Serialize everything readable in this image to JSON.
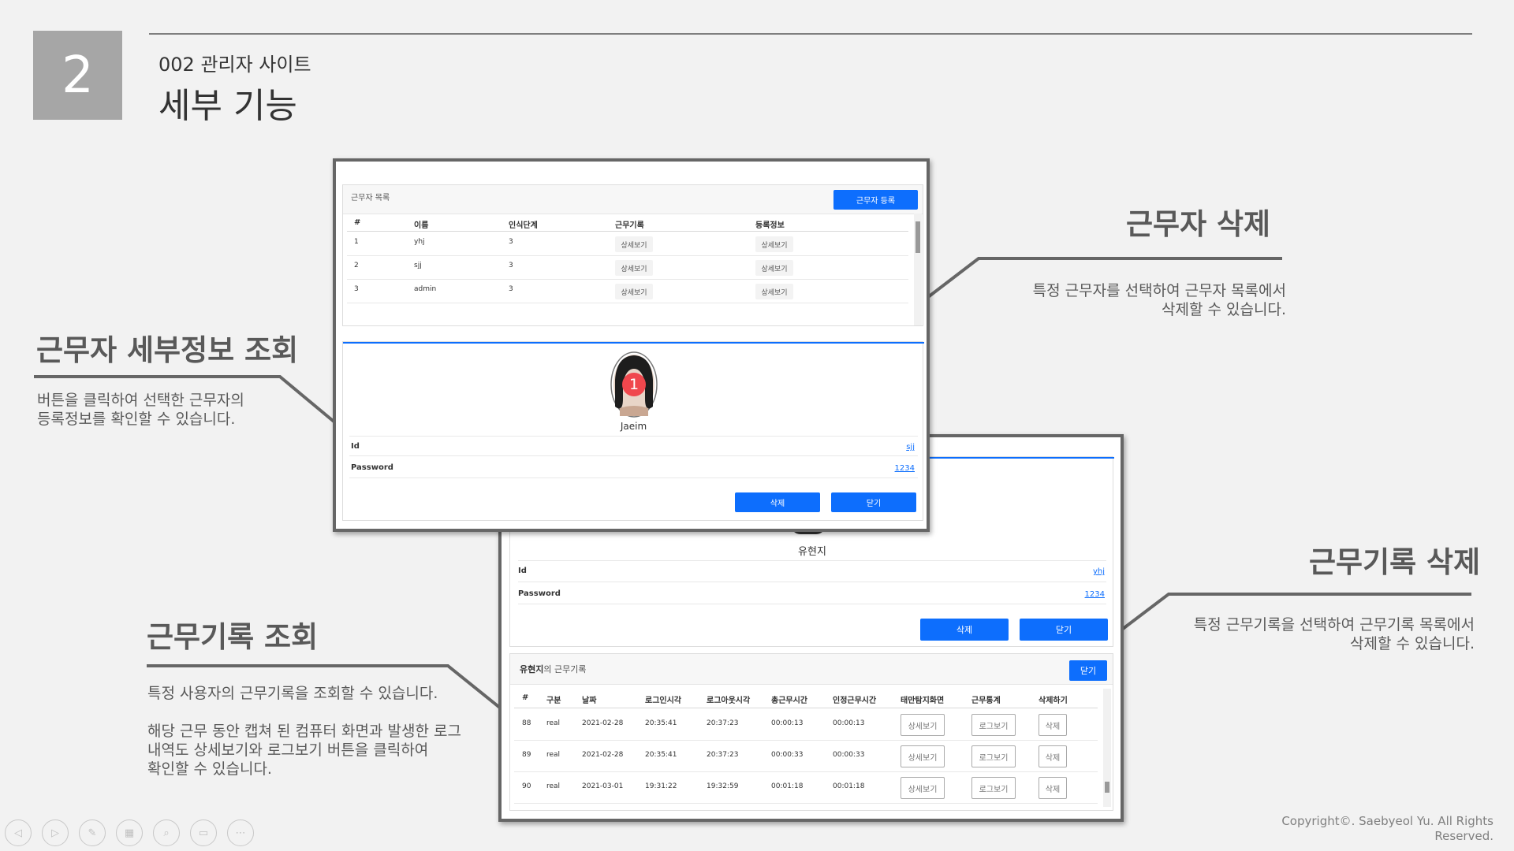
{
  "slide": {
    "number": "2",
    "subtitle": "002 관리자 사이트",
    "title": "세부 기능",
    "copyright_line1": "Copyright©. Saebyeol Yu. All Rights",
    "copyright_line2": "Reserved."
  },
  "sections": {
    "worker_detail": {
      "heading": "근무자 세부정보 조회",
      "desc1": "버튼을 클릭하여 선택한 근무자의",
      "desc2": "등록정보를 확인할 수 있습니다."
    },
    "worker_delete": {
      "heading": "근무자 삭제",
      "desc1": "특정 근무자를 선택하여 근무자 목록에서",
      "desc2": "삭제할 수 있습니다."
    },
    "record_view": {
      "heading": "근무기록 조회",
      "desc1": "특정 사용자의 근무기록을 조회할 수 있습니다.",
      "desc2": "해당 근무 동안 캡쳐 된 컴퓨터 화면과 발생한 로그",
      "desc3": "내역도 상세보기와 로그보기 버튼을 클릭하여",
      "desc4": "확인할 수 있습니다."
    },
    "record_delete": {
      "heading": "근무기록 삭제",
      "desc1": "특정 근무기록을 선택하여 근무기록 목록에서",
      "desc2": "삭제할 수 있습니다."
    }
  },
  "worker_window": {
    "list_title": "근무자 목록",
    "register_button": "근무자 등록",
    "columns": [
      "#",
      "이름",
      "인식단계",
      "근무기록",
      "등록정보"
    ],
    "rows": [
      {
        "num": "1",
        "name": "yhj",
        "stage": "3",
        "record_btn": "상세보기",
        "info_btn": "상세보기"
      },
      {
        "num": "2",
        "name": "sjj",
        "stage": "3",
        "record_btn": "상세보기",
        "info_btn": "상세보기"
      },
      {
        "num": "3",
        "name": "admin",
        "stage": "3",
        "record_btn": "상세보기",
        "info_btn": "상세보기"
      }
    ],
    "profile_name": "Jaeim",
    "badge": "1",
    "id_label": "Id",
    "id_value": "sjj",
    "password_label": "Password",
    "password_value": "1234",
    "delete_button": "삭제",
    "close_button": "닫기"
  },
  "record_window": {
    "profile_name": "유현지",
    "id_label": "Id",
    "id_value": "yhj",
    "password_label": "Password",
    "password_value": "1234",
    "delete_button": "삭제",
    "close_button": "닫기",
    "records_owner": "유현지",
    "records_title_suffix": "의 근무기록",
    "records_close": "닫기",
    "columns": [
      "#",
      "구분",
      "날짜",
      "로그인시각",
      "로그아웃시각",
      "총근무시간",
      "인정근무시간",
      "태만탐지화면",
      "근무통계",
      "삭제하기"
    ],
    "rows": [
      {
        "num": "88",
        "type": "real",
        "date": "2021-02-28",
        "login": "20:35:41",
        "logout": "20:37:23",
        "total": "00:00:13",
        "approved": "00:00:13",
        "detail_btn": "상세보기",
        "log_btn": "로그보기",
        "del_btn": "삭제"
      },
      {
        "num": "89",
        "type": "real",
        "date": "2021-02-28",
        "login": "20:35:41",
        "logout": "20:37:23",
        "total": "00:00:33",
        "approved": "00:00:33",
        "detail_btn": "상세보기",
        "log_btn": "로그보기",
        "del_btn": "삭제"
      },
      {
        "num": "90",
        "type": "real",
        "date": "2021-03-01",
        "login": "19:31:22",
        "logout": "19:32:59",
        "total": "00:01:18",
        "approved": "00:01:18",
        "detail_btn": "상세보기",
        "log_btn": "로그보기",
        "del_btn": "삭제"
      }
    ]
  },
  "nav_icons": [
    "prev-icon",
    "next-icon",
    "pen-icon",
    "slides-icon",
    "zoom-icon",
    "subtitle-icon",
    "more-icon"
  ],
  "colors": {
    "accent": "#0d6efd",
    "badge": "#f0474d",
    "gray_box": "#a6a6a6"
  }
}
